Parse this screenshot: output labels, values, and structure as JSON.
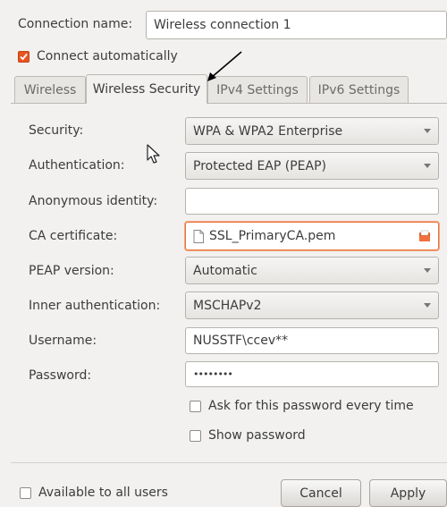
{
  "connection": {
    "name_label": "Connection name:",
    "name_value": "Wireless connection 1"
  },
  "connect_auto": {
    "label": "Connect automatically",
    "checked": true
  },
  "tabs": [
    {
      "label": "Wireless"
    },
    {
      "label": "Wireless Security"
    },
    {
      "label": "IPv4 Settings"
    },
    {
      "label": "IPv6 Settings"
    }
  ],
  "form": {
    "security": {
      "label": "Security:",
      "value": "WPA & WPA2 Enterprise"
    },
    "authentication": {
      "label": "Authentication:",
      "value": "Protected EAP (PEAP)"
    },
    "anonymous_identity": {
      "label": "Anonymous identity:",
      "value": ""
    },
    "ca_certificate": {
      "label": "CA certificate:",
      "value": "SSL_PrimaryCA.pem"
    },
    "peap_version": {
      "label": "PEAP version:",
      "value": "Automatic"
    },
    "inner_auth": {
      "label": "Inner authentication:",
      "value": "MSCHAPv2"
    },
    "username": {
      "label": "Username:",
      "value": "NUSSTF\\ccev**"
    },
    "password": {
      "label": "Password:",
      "value": "••••••••"
    }
  },
  "options": {
    "ask_password": {
      "label": "Ask for this password every time",
      "checked": false
    },
    "show_password": {
      "label": "Show password",
      "checked": false
    }
  },
  "footer": {
    "available_all": "Available to all users",
    "cancel": "Cancel",
    "apply": "Apply"
  },
  "colors": {
    "accent": "#e95420",
    "window_bg": "#f2f1f0"
  }
}
